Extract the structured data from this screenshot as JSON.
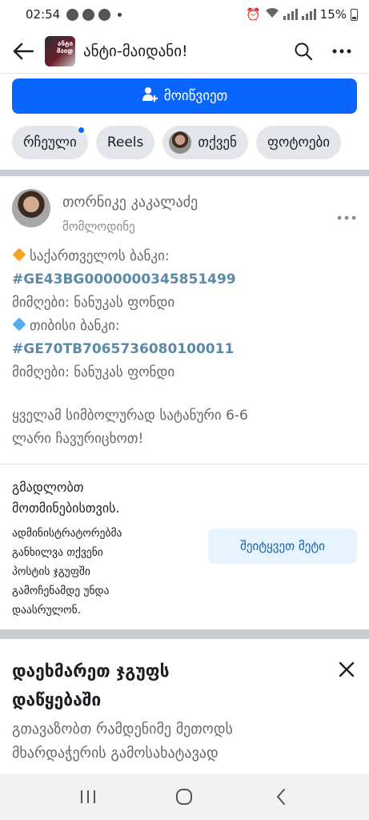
{
  "status_bar": {
    "time": "02:54",
    "battery": "15%"
  },
  "header": {
    "group_name": "ანტი-მაიდანი!",
    "thumb_text": "ანტი მაიდ"
  },
  "invite": {
    "label": "მოიწვიეთ"
  },
  "chips": [
    {
      "label": "რჩეული"
    },
    {
      "label": "Reels"
    },
    {
      "label": "თქვენ"
    },
    {
      "label": "ფოტოები"
    }
  ],
  "post": {
    "author": "თორნიკე კაკალაძე",
    "status": "მომლოდინე",
    "lines": {
      "bank1": "საქართველოს ბანკი:",
      "iban1": "#GE43BG0000000345851499",
      "recipient1": "მიმღები: ნანუკას ფონდი",
      "bank2": "თიბისი ბანკი:",
      "iban2": "#GE70TB7065736080100011",
      "recipient2": "მიმღები: ნანუკას ფონდი",
      "appeal_1": "ყველამ სიმბოლურად სატანური 6-6",
      "appeal_2": "ლარი ჩავურიცხოთ!"
    },
    "bullet_colors": {
      "bank1": "#f5a623",
      "bank2": "#55acee"
    }
  },
  "pending": {
    "title_1": "გმადლობთ",
    "title_2": "მოთმინებისთვის.",
    "desc_lines": [
      "ადმინისტრატორებმა",
      "განხილვა თქვენი",
      "პოსტის ჯგუფში",
      "გამოჩენამდე უნდა",
      "დაასრულონ."
    ],
    "button": "შეიტყვეთ მეტი"
  },
  "help_card": {
    "title_1": "დაეხმარეთ ჯგუფს",
    "title_2": "დაწყებაში",
    "sub_1": "გთავაზობთ რამდენიმე მეთოდს",
    "sub_2": "მხარდაჭერის გამოსახატავად"
  },
  "colors": {
    "accent": "#0866ff",
    "link_tag": "#5b89a8",
    "muted": "#65676b"
  }
}
